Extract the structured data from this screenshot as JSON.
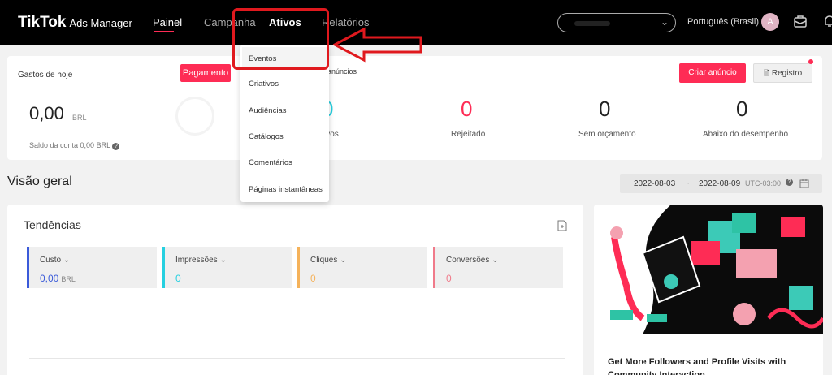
{
  "header": {
    "logo": "TikTok",
    "logo_sub": "Ads Manager",
    "nav": [
      "Painel",
      "Campanha",
      "Ativos",
      "Relatórios"
    ],
    "language": "Português (Brasil)",
    "avatar": "A"
  },
  "today": {
    "label": "Gastos de hoje",
    "payment_button": "Pagamento",
    "spend_value": "0,00",
    "currency": "BRL",
    "balance": "Saldo da conta 0,00 BRL",
    "ads_label": "anúncios",
    "stats": [
      {
        "value": "0",
        "label": "ivos",
        "color": "#25d0e0"
      },
      {
        "value": "0",
        "label": "Rejeitado",
        "color": "#fe2c55"
      },
      {
        "value": "0",
        "label": "Sem orçamento",
        "color": "#222222"
      },
      {
        "value": "0",
        "label": "Abaixo do desempenho",
        "color": "#222222"
      }
    ],
    "create_button": "Criar anúncio",
    "record_button": "Registro"
  },
  "overview": {
    "title": "Visão geral",
    "date_start": "2022-08-03",
    "date_sep": "~",
    "date_end": "2022-08-09",
    "timezone": "UTC-03:00"
  },
  "trends": {
    "title": "Tendências",
    "metrics": [
      {
        "label": "Custo",
        "value": "0,00",
        "unit": "BRL",
        "color": "#3a5ad9"
      },
      {
        "label": "Impressões",
        "value": "0",
        "unit": "",
        "color": "#25d0e0"
      },
      {
        "label": "Cliques",
        "value": "0",
        "unit": "",
        "color": "#f5b25a"
      },
      {
        "label": "Conversões",
        "value": "0",
        "unit": "",
        "color": "#f07a8a"
      }
    ]
  },
  "promo": {
    "text": "Get More Followers and Profile Visits with Community Interaction"
  },
  "dropdown": {
    "items": [
      "Eventos",
      "Criativos",
      "Audiências",
      "Catálogos",
      "Comentários",
      "Páginas instantâneas"
    ]
  },
  "colors": {
    "accent": "#fe2c55",
    "annotation": "#e0191e"
  }
}
